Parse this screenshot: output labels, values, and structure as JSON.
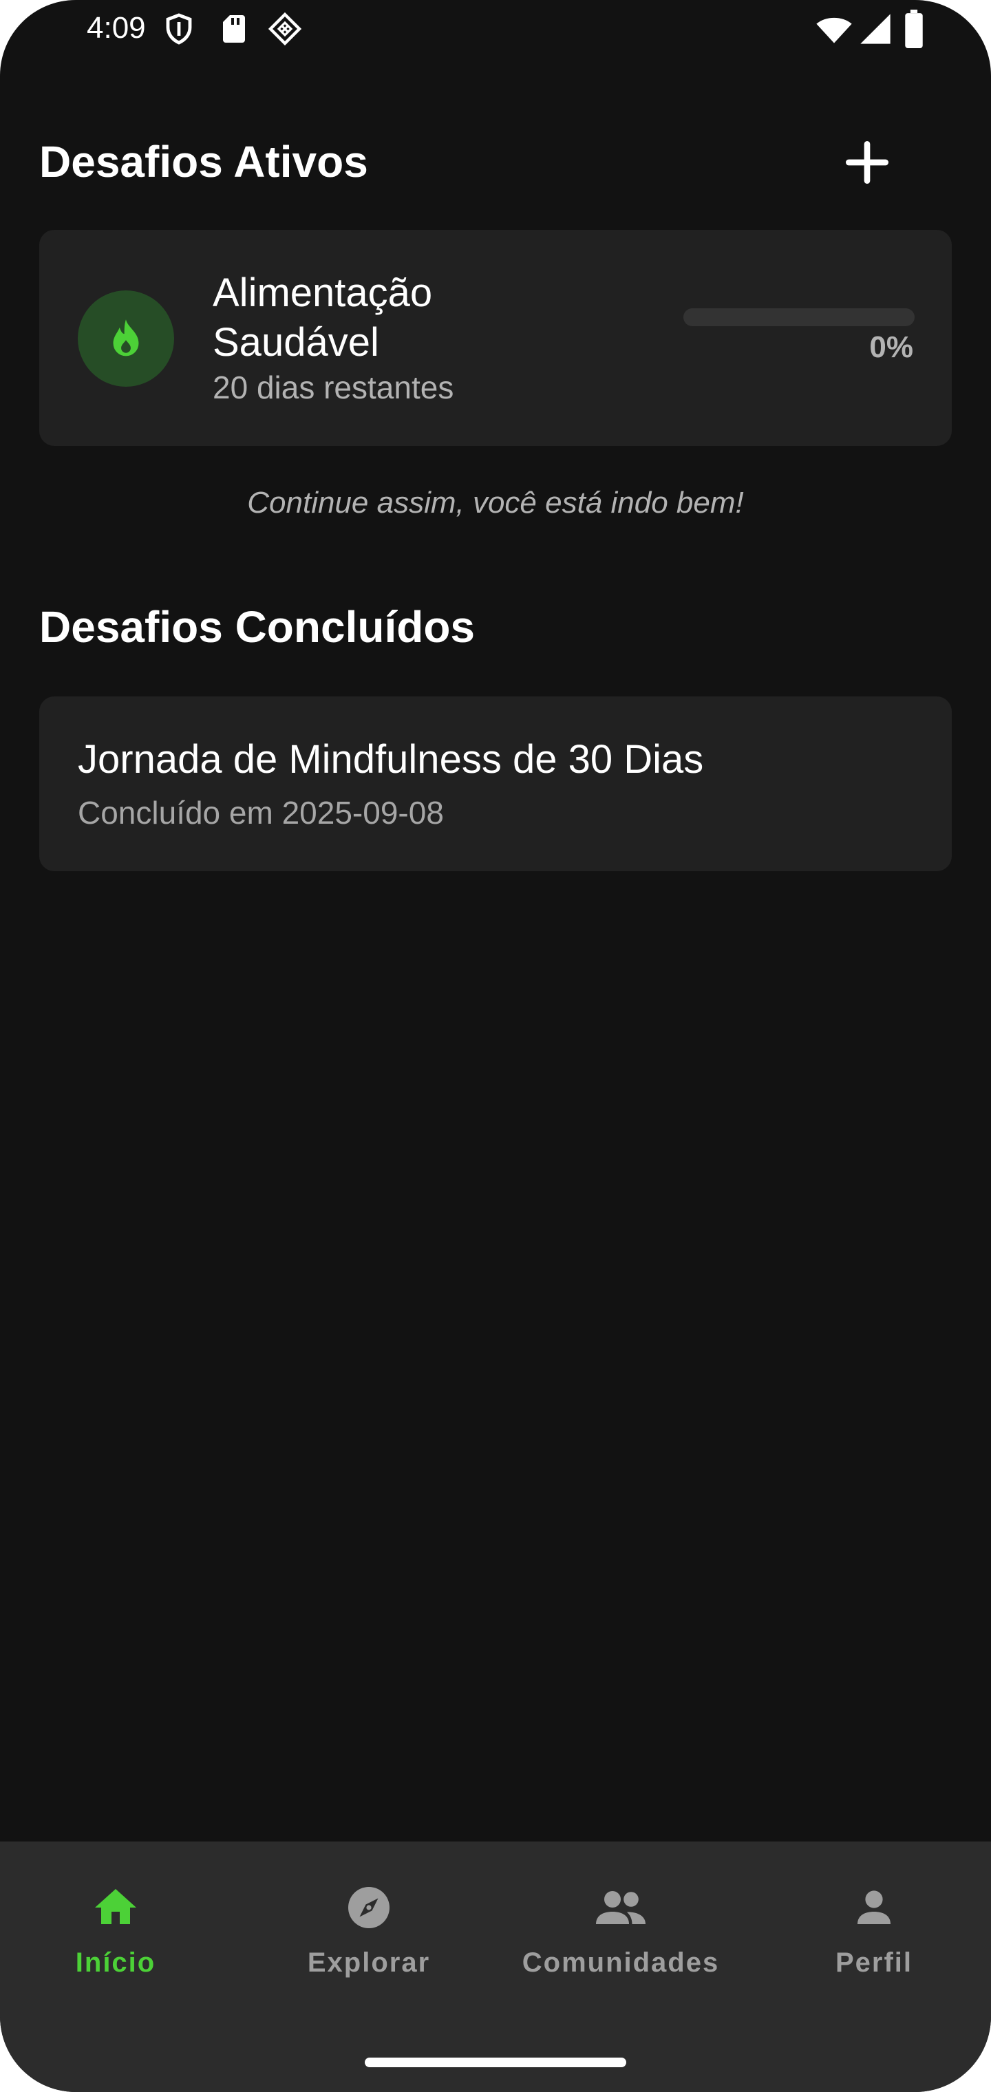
{
  "status_bar": {
    "time": "4:09",
    "left_icons": [
      "shield-icon",
      "sd-card-icon",
      "diamond-app-icon"
    ],
    "right_icons": [
      "wifi-icon",
      "signal-icon",
      "battery-icon"
    ]
  },
  "active_section": {
    "title": "Desafios Ativos",
    "add_icon": "plus-icon",
    "challenges": [
      {
        "name": "Alimentação Saudável",
        "remaining": "20 dias restantes",
        "progress_label": "0%",
        "progress_fraction": 0,
        "icon": "fire-icon"
      }
    ],
    "motivation": "Continue assim, você está indo bem!"
  },
  "completed_section": {
    "title": "Desafios Concluídos",
    "challenges": [
      {
        "name": "Jornada de Mindfulness de 30 Dias",
        "completed_on": "Concluído em 2025-09-08"
      }
    ]
  },
  "bottom_nav": {
    "items": [
      {
        "label": "Início",
        "icon": "home-icon",
        "active": true
      },
      {
        "label": "Explorar",
        "icon": "compass-icon",
        "active": false
      },
      {
        "label": "Comunidades",
        "icon": "people-icon",
        "active": false
      },
      {
        "label": "Perfil",
        "icon": "person-icon",
        "active": false
      }
    ]
  },
  "colors": {
    "background": "#121212",
    "card": "#212121",
    "accent": "#4cd137",
    "muted_text": "#b3b3b3",
    "nav_background": "#2c2c2c"
  }
}
